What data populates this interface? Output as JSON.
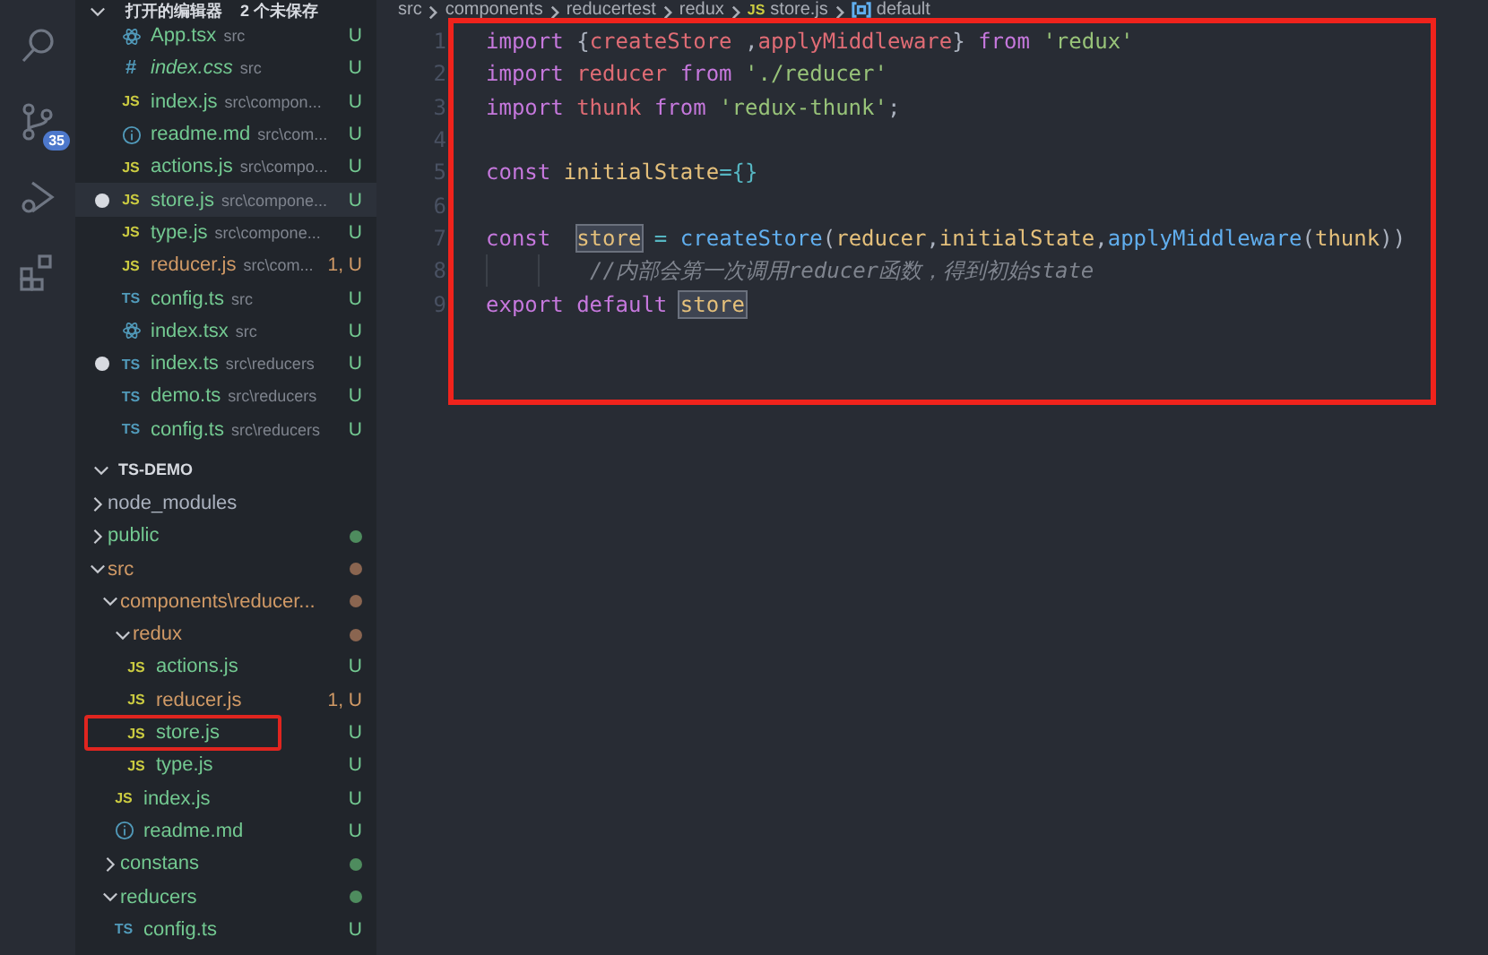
{
  "activity_bar": {
    "items": [
      {
        "kind": "search"
      },
      {
        "kind": "source-control",
        "badge": "35"
      },
      {
        "kind": "debug"
      },
      {
        "kind": "extensions"
      }
    ]
  },
  "sidebar": {
    "open_editors": {
      "title": "打开的编辑器",
      "unsaved": "2 个未保存",
      "items": [
        {
          "kind": "react",
          "name": "App.tsx",
          "path": "src",
          "badge": "U",
          "has_errors": false,
          "dirty": false,
          "selected": false,
          "italic": false
        },
        {
          "kind": "css",
          "icon_label": "#",
          "name": "index.css",
          "path": "src",
          "badge": "U",
          "has_errors": false,
          "dirty": false,
          "selected": false,
          "italic": true
        },
        {
          "kind": "js",
          "icon_label": "JS",
          "name": "index.js",
          "path": "src\\compon...",
          "badge": "U",
          "has_errors": false,
          "dirty": false,
          "selected": false,
          "italic": false
        },
        {
          "kind": "info",
          "name": "readme.md",
          "path": "src\\com...",
          "badge": "U",
          "has_errors": false,
          "dirty": false,
          "selected": false,
          "italic": false
        },
        {
          "kind": "js",
          "icon_label": "JS",
          "name": "actions.js",
          "path": "src\\compo...",
          "badge": "U",
          "has_errors": false,
          "dirty": false,
          "selected": false,
          "italic": false
        },
        {
          "kind": "js",
          "icon_label": "JS",
          "name": "store.js",
          "path": "src\\compone...",
          "badge": "U",
          "has_errors": false,
          "dirty": true,
          "selected": true,
          "italic": false
        },
        {
          "kind": "js",
          "icon_label": "JS",
          "name": "type.js",
          "path": "src\\compone...",
          "badge": "U",
          "has_errors": false,
          "dirty": false,
          "selected": false,
          "italic": false
        },
        {
          "kind": "js",
          "icon_label": "JS",
          "name": "reducer.js",
          "path": "src\\com...",
          "badge": "1, U",
          "has_errors": true,
          "dirty": false,
          "selected": false,
          "italic": false
        },
        {
          "kind": "ts",
          "icon_label": "TS",
          "name": "config.ts",
          "path": "src",
          "badge": "U",
          "has_errors": false,
          "dirty": false,
          "selected": false,
          "italic": false
        },
        {
          "kind": "react",
          "name": "index.tsx",
          "path": "src",
          "badge": "U",
          "has_errors": false,
          "dirty": false,
          "selected": false,
          "italic": false
        },
        {
          "kind": "ts",
          "icon_label": "TS",
          "name": "index.ts",
          "path": "src\\reducers",
          "badge": "U",
          "has_errors": false,
          "dirty": true,
          "selected": false,
          "italic": false
        },
        {
          "kind": "ts",
          "icon_label": "TS",
          "name": "demo.ts",
          "path": "src\\reducers",
          "badge": "U",
          "has_errors": false,
          "dirty": false,
          "selected": false,
          "italic": false
        },
        {
          "kind": "ts",
          "icon_label": "TS",
          "name": "config.ts",
          "path": "src\\reducers",
          "badge": "U",
          "has_errors": false,
          "dirty": false,
          "selected": false,
          "italic": false
        }
      ]
    },
    "explorer": {
      "title": "TS-DEMO",
      "expanded": true,
      "items": [
        {
          "kind": "folder",
          "name": "node_modules",
          "expanded": false,
          "has_errors": false,
          "ignored": true
        },
        {
          "kind": "folder",
          "name": "public",
          "expanded": false,
          "has_errors": false,
          "ignored": false,
          "color": "#4e8c5e"
        },
        {
          "kind": "folder",
          "name": "src",
          "expanded": true,
          "has_errors": true,
          "ignored": false,
          "color": "#8a6550",
          "children": [
            {
              "kind": "folder",
              "name": "components\\reducer...",
              "expanded": true,
              "has_errors": true,
              "ignored": false,
              "color": "#8a6550",
              "children": [
                {
                  "kind": "folder",
                  "name": "redux",
                  "expanded": true,
                  "has_errors": true,
                  "ignored": false,
                  "color": "#8a6550",
                  "children": [
                    {
                      "kind": "js",
                      "icon_label": "JS",
                      "name": "actions.js",
                      "badge": "U",
                      "has_errors": false,
                      "ignored": false,
                      "annotated": false
                    },
                    {
                      "kind": "js",
                      "icon_label": "JS",
                      "name": "reducer.js",
                      "badge": "1, U",
                      "has_errors": true,
                      "ignored": false,
                      "annotated": false
                    },
                    {
                      "kind": "js",
                      "icon_label": "JS",
                      "name": "store.js",
                      "badge": "U",
                      "has_errors": false,
                      "ignored": false,
                      "annotated": true
                    },
                    {
                      "kind": "js",
                      "icon_label": "JS",
                      "name": "type.js",
                      "badge": "U",
                      "has_errors": false,
                      "ignored": false,
                      "annotated": false
                    }
                  ]
                },
                {
                  "kind": "js",
                  "icon_label": "JS",
                  "name": "index.js",
                  "badge": "U",
                  "has_errors": false,
                  "ignored": false,
                  "annotated": false
                },
                {
                  "kind": "info",
                  "name": "readme.md",
                  "badge": "U",
                  "has_errors": false,
                  "ignored": false,
                  "annotated": false
                }
              ]
            },
            {
              "kind": "folder",
              "name": "constans",
              "expanded": false,
              "has_errors": false,
              "ignored": false,
              "color": "#4e8c5e"
            },
            {
              "kind": "folder",
              "name": "reducers",
              "expanded": true,
              "has_errors": false,
              "ignored": false,
              "color": "#4e8c5e",
              "children": [
                {
                  "kind": "ts",
                  "icon_label": "TS",
                  "name": "config.ts",
                  "badge": "U",
                  "has_errors": false,
                  "ignored": false,
                  "annotated": false
                }
              ]
            }
          ]
        }
      ]
    }
  },
  "editor": {
    "breadcrumbs": [
      {
        "kind": "text",
        "label": "src"
      },
      {
        "kind": "text",
        "label": "components"
      },
      {
        "kind": "text",
        "label": "reducertest"
      },
      {
        "kind": "text",
        "label": "redux"
      },
      {
        "kind": "js",
        "icon_label": "JS",
        "label": "store.js"
      },
      {
        "kind": "symbol",
        "label": "default"
      }
    ],
    "annotated": true,
    "lines": [
      {
        "number": "1",
        "indent_guides": false,
        "tokens": [
          {
            "kind": "keyword",
            "text": "import"
          },
          {
            "kind": "punct",
            "text": " {"
          },
          {
            "kind": "name",
            "text": "createStore"
          },
          {
            "kind": "punct",
            "text": " ,"
          },
          {
            "kind": "name",
            "text": "applyMiddleware"
          },
          {
            "kind": "punct",
            "text": "} "
          },
          {
            "kind": "keyword",
            "text": "from"
          },
          {
            "kind": "string",
            "text": " 'redux'"
          }
        ]
      },
      {
        "number": "2",
        "indent_guides": false,
        "tokens": [
          {
            "kind": "keyword",
            "text": "import "
          },
          {
            "kind": "name",
            "text": "reducer "
          },
          {
            "kind": "keyword",
            "text": "from "
          },
          {
            "kind": "string",
            "text": "'./reducer'"
          }
        ]
      },
      {
        "number": "3",
        "indent_guides": false,
        "tokens": [
          {
            "kind": "keyword",
            "text": "import "
          },
          {
            "kind": "name",
            "text": "thunk "
          },
          {
            "kind": "keyword",
            "text": "from "
          },
          {
            "kind": "string",
            "text": "'redux-thunk'"
          },
          {
            "kind": "punct",
            "text": ";"
          }
        ]
      },
      {
        "number": "4",
        "indent_guides": false
      },
      {
        "number": "5",
        "indent_guides": false,
        "tokens": [
          {
            "kind": "keyword",
            "text": "const "
          },
          {
            "kind": "variable",
            "text": "initialState"
          },
          {
            "kind": "operator",
            "text": "={}"
          }
        ]
      },
      {
        "number": "6",
        "indent_guides": false
      },
      {
        "number": "7",
        "indent_guides": false,
        "tokens": [
          {
            "kind": "keyword",
            "text": "const  "
          },
          {
            "kind": "variable",
            "text": "store",
            "highlight": true
          },
          {
            "kind": "operator",
            "text": " = "
          },
          {
            "kind": "function",
            "text": "createStore"
          },
          {
            "kind": "punct",
            "text": "("
          },
          {
            "kind": "variable",
            "text": "reducer"
          },
          {
            "kind": "punct",
            "text": ","
          },
          {
            "kind": "variable",
            "text": "initialState"
          },
          {
            "kind": "punct",
            "text": ","
          },
          {
            "kind": "function",
            "text": "applyMiddleware"
          },
          {
            "kind": "punct",
            "text": "("
          },
          {
            "kind": "variable",
            "text": "thunk"
          },
          {
            "kind": "punct",
            "text": "))"
          }
        ]
      },
      {
        "number": "8",
        "indent_guides": true,
        "tokens": [
          {
            "kind": "comment",
            "text": "//内部会第一次调用reducer函数，得到初始state"
          }
        ]
      },
      {
        "number": "9",
        "indent_guides": false,
        "tokens": [
          {
            "kind": "keyword",
            "text": "export "
          },
          {
            "kind": "keyword",
            "text": "default "
          },
          {
            "kind": "variable",
            "text": "store",
            "highlight": true
          }
        ]
      }
    ]
  }
}
